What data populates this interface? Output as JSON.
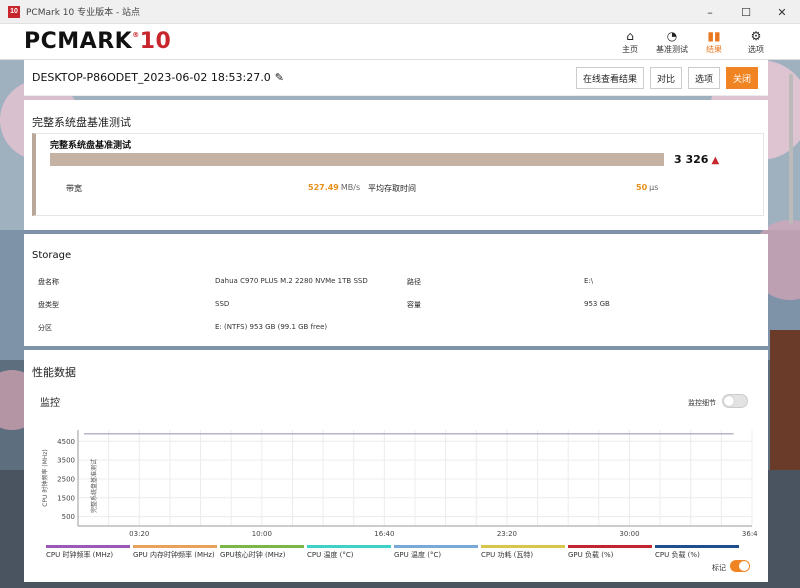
{
  "window": {
    "title": "PCMark 10 专业版本 - 站点",
    "app_icon": "10",
    "controls": {
      "minimize": "–",
      "maximize": "☐",
      "close": "✕"
    }
  },
  "header": {
    "logo_main": "PCMARK",
    "logo_num": "10",
    "logo_reg": "®",
    "nav": [
      {
        "label": "主页",
        "icon": "home-icon",
        "active": false
      },
      {
        "label": "基准测试",
        "icon": "gauge-icon",
        "active": false
      },
      {
        "label": "结果",
        "icon": "bar-chart-icon",
        "active": true
      },
      {
        "label": "选项",
        "icon": "gear-icon",
        "active": false
      }
    ]
  },
  "result": {
    "title": "DESKTOP-P86ODET_2023-06-02 18:53:27.0",
    "buttons": {
      "online": "在线查看结果",
      "compare": "对比",
      "options": "选项",
      "close": "关闭"
    }
  },
  "test": {
    "section_title": "完整系统盘基准测试",
    "name": "完整系统盘基准测试",
    "score": "3 326",
    "bandwidth_label": "带宽",
    "bandwidth_value": "527.49",
    "bandwidth_unit": "MB/s",
    "access_label": "平均存取时间",
    "access_value": "50",
    "access_unit": "μs"
  },
  "storage": {
    "title": "Storage",
    "rows": [
      {
        "label": "盘名称",
        "value": "Dahua C970 PLUS M.2 2280 NVMe 1TB SSD",
        "label2": "路径",
        "value2": "E:\\"
      },
      {
        "label": "盘类型",
        "value": "SSD",
        "label2": "容量",
        "value2": "953 GB"
      },
      {
        "label": "分区",
        "value": "E: (NTFS) 953 GB (99.1 GB free)",
        "label2": "",
        "value2": ""
      }
    ]
  },
  "perf": {
    "title": "性能数据",
    "monitor_title": "监控",
    "monitor_detail_label": "监控细节",
    "mark_label": "标记"
  },
  "colors": {
    "accent": "#f08422",
    "score_bar": "#c4b2a4",
    "warn": "#c8262d"
  },
  "chart_data": {
    "type": "line",
    "ylabel": "CPU 时钟频率 (MHz)",
    "y_ticks": [
      "500",
      "1500",
      "2500",
      "3500",
      "4500"
    ],
    "ylim": [
      0,
      5100
    ],
    "x_ticks": [
      "03:20",
      "10:00",
      "16:40",
      "23:20",
      "30:00",
      "36:40"
    ],
    "x_tick_values": [
      200,
      600,
      1000,
      1400,
      1800,
      2200
    ],
    "xlim": [
      0,
      2200
    ],
    "annotation": "完整系统盘基准测试",
    "grid": true,
    "series": [
      {
        "name": "CPU 时钟频率 (MHz)",
        "color": "#9b59b6",
        "x": [
          20,
          2140
        ],
        "y": [
          4900,
          4900
        ]
      }
    ],
    "legend": [
      {
        "name": "CPU 时钟频率 (MHz)",
        "color": "#9b59b6"
      },
      {
        "name": "GPU 内存时钟频率 (MHz)",
        "color": "#e8a05a"
      },
      {
        "name": "GPU核心时钟 (MHz)",
        "color": "#7ab648"
      },
      {
        "name": "CPU 温度 (°C)",
        "color": "#3fd0c9"
      },
      {
        "name": "GPU 温度 (°C)",
        "color": "#7aa8d8"
      },
      {
        "name": "CPU 功耗 (瓦特)",
        "color": "#d8c64a"
      },
      {
        "name": "GPU 负载 (%)",
        "color": "#c0262e"
      },
      {
        "name": "CPU 负载 (%)",
        "color": "#1f4e8c"
      }
    ]
  }
}
